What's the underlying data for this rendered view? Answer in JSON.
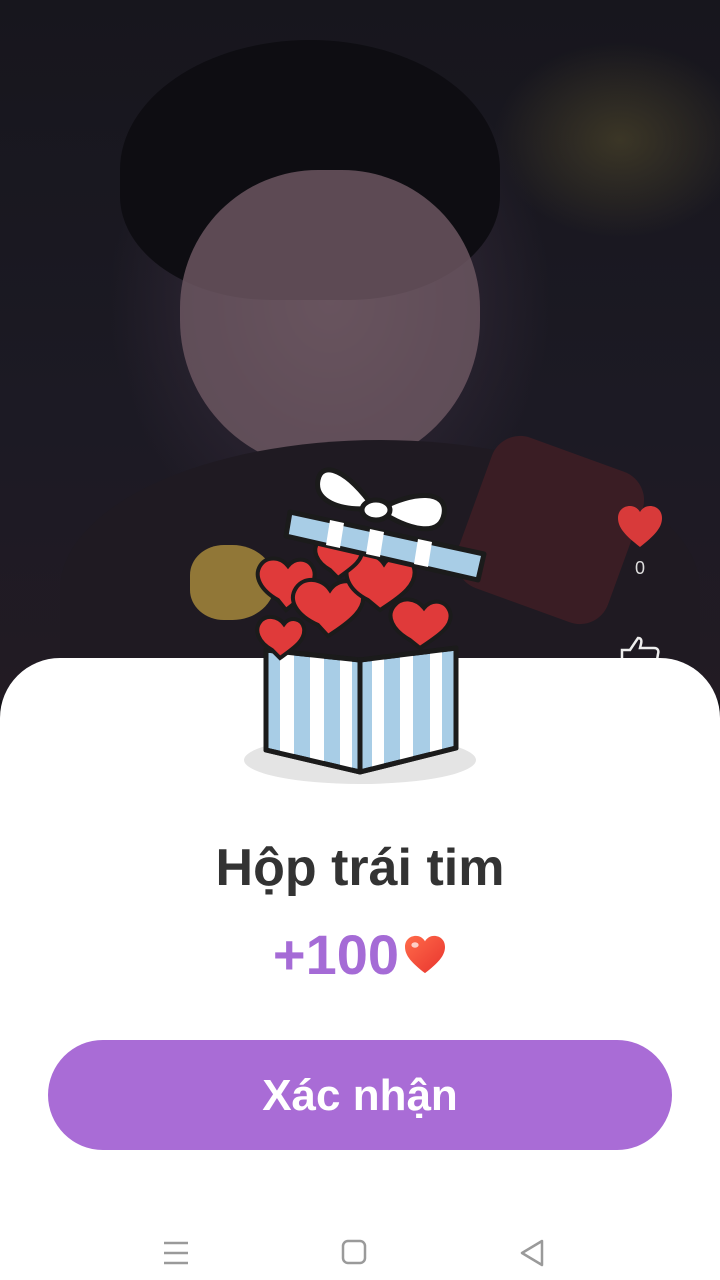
{
  "video": {
    "like_count": "0"
  },
  "dialog": {
    "title": "Hộp trái tim",
    "reward_amount": "+100",
    "reward_icon": "heart-icon",
    "confirm_label": "Xác nhận"
  },
  "colors": {
    "accent": "#a96cd6",
    "reward_text": "#a56bd6",
    "title_text": "#333333",
    "heart": "#d83a3a",
    "box_blue": "#a8cde6"
  },
  "navbar": {
    "icons": [
      "menu-icon",
      "home-icon",
      "back-icon"
    ]
  }
}
